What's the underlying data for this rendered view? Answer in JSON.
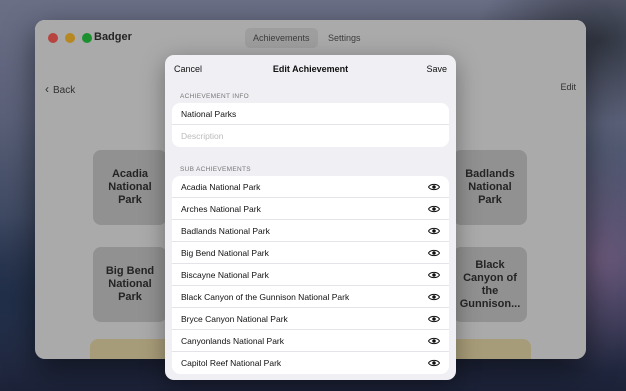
{
  "window": {
    "app_title": "Badger",
    "tabs": [
      "Achievements",
      "Settings"
    ],
    "back_label": "Back",
    "edit_label": "Edit",
    "tiles": [
      "Acadia National Park",
      "Badlands National Park",
      "Big Bend National Park",
      "Black Canyon of the Gunnison..."
    ]
  },
  "sheet": {
    "cancel_label": "Cancel",
    "title": "Edit Achievement",
    "save_label": "Save",
    "info_section_label": "ACHIEVEMENT INFO",
    "name_value": "National Parks",
    "description_placeholder": "Description",
    "sub_section_label": "SUB ACHIEVEMENTS",
    "sub_achievements": [
      "Acadia National Park",
      "Arches National Park",
      "Badlands National Park",
      "Big Bend National Park",
      "Biscayne National Park",
      "Black Canyon of the Gunnison National Park",
      "Bryce Canyon National Park",
      "Canyonlands National Park",
      "Capitol Reef National Park"
    ],
    "row_icon": "eye-icon"
  }
}
